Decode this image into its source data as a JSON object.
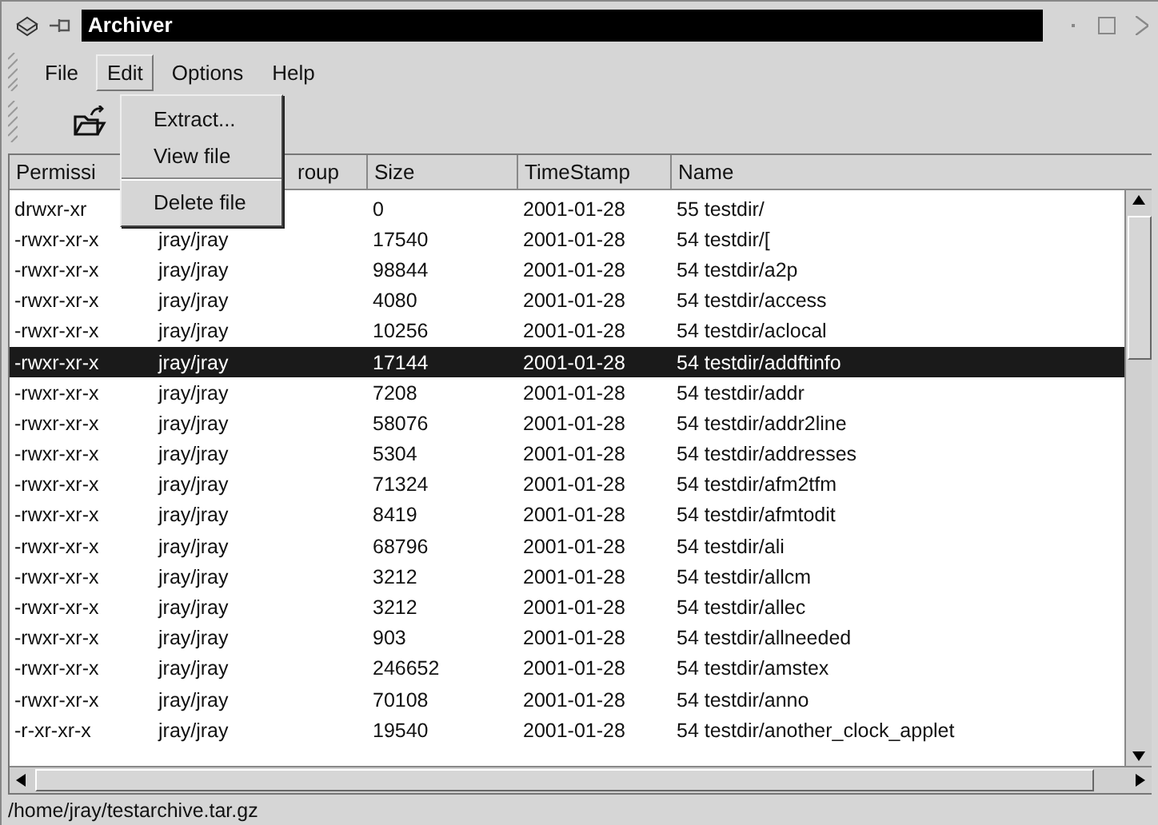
{
  "window": {
    "title": "Archiver"
  },
  "menubar": [
    {
      "label": "File",
      "selected": false
    },
    {
      "label": "Edit",
      "selected": true
    },
    {
      "label": "Options",
      "selected": false
    },
    {
      "label": "Help",
      "selected": false
    }
  ],
  "edit_menu": {
    "items": [
      {
        "label": "Extract...",
        "kind": "item"
      },
      {
        "label": "View file",
        "kind": "item"
      },
      {
        "kind": "separator"
      },
      {
        "label": "Delete file",
        "kind": "item"
      }
    ]
  },
  "table": {
    "columns": [
      "Permissi",
      "roup",
      "Size",
      "TimeStamp",
      "Name"
    ],
    "rows": [
      {
        "cells": [
          "drwxr-xr",
          "",
          "0",
          "2001-01-28",
          "55 testdir/"
        ],
        "selected": false
      },
      {
        "cells": [
          "-rwxr-xr-x",
          "jray/jray",
          "17540",
          "2001-01-28",
          "54 testdir/["
        ],
        "selected": false
      },
      {
        "cells": [
          "-rwxr-xr-x",
          "jray/jray",
          "98844",
          "2001-01-28",
          "54 testdir/a2p"
        ],
        "selected": false
      },
      {
        "cells": [
          "-rwxr-xr-x",
          "jray/jray",
          "4080",
          "2001-01-28",
          "54 testdir/access"
        ],
        "selected": false
      },
      {
        "cells": [
          "-rwxr-xr-x",
          "jray/jray",
          "10256",
          "2001-01-28",
          "54 testdir/aclocal"
        ],
        "selected": false
      },
      {
        "cells": [
          "-rwxr-xr-x",
          "jray/jray",
          "17144",
          "2001-01-28",
          "54 testdir/addftinfo"
        ],
        "selected": true
      },
      {
        "cells": [
          "-rwxr-xr-x",
          "jray/jray",
          "7208",
          "2001-01-28",
          "54 testdir/addr"
        ],
        "selected": false
      },
      {
        "cells": [
          "-rwxr-xr-x",
          "jray/jray",
          "58076",
          "2001-01-28",
          "54 testdir/addr2line"
        ],
        "selected": false
      },
      {
        "cells": [
          "-rwxr-xr-x",
          "jray/jray",
          "5304",
          "2001-01-28",
          "54 testdir/addresses"
        ],
        "selected": false
      },
      {
        "cells": [
          "-rwxr-xr-x",
          "jray/jray",
          "71324",
          "2001-01-28",
          "54 testdir/afm2tfm"
        ],
        "selected": false
      },
      {
        "cells": [
          "-rwxr-xr-x",
          "jray/jray",
          "8419",
          "2001-01-28",
          "54 testdir/afmtodit"
        ],
        "selected": false
      },
      {
        "cells": [
          "-rwxr-xr-x",
          "jray/jray",
          "68796",
          "2001-01-28",
          "54 testdir/ali"
        ],
        "selected": false
      },
      {
        "cells": [
          "-rwxr-xr-x",
          "jray/jray",
          "3212",
          "2001-01-28",
          "54 testdir/allcm"
        ],
        "selected": false
      },
      {
        "cells": [
          "-rwxr-xr-x",
          "jray/jray",
          "3212",
          "2001-01-28",
          "54 testdir/allec"
        ],
        "selected": false
      },
      {
        "cells": [
          "-rwxr-xr-x",
          "jray/jray",
          "903",
          "2001-01-28",
          "54 testdir/allneeded"
        ],
        "selected": false
      },
      {
        "cells": [
          "-rwxr-xr-x",
          "jray/jray",
          "246652",
          "2001-01-28",
          "54 testdir/amstex"
        ],
        "selected": false
      },
      {
        "cells": [
          "-rwxr-xr-x",
          "jray/jray",
          "70108",
          "2001-01-28",
          "54 testdir/anno"
        ],
        "selected": false
      },
      {
        "cells": [
          "-r-xr-xr-x",
          "jray/jray",
          "19540",
          "2001-01-28",
          "54 testdir/another_clock_applet"
        ],
        "selected": false
      }
    ]
  },
  "status_bar": "/home/jray/testarchive.tar.gz"
}
